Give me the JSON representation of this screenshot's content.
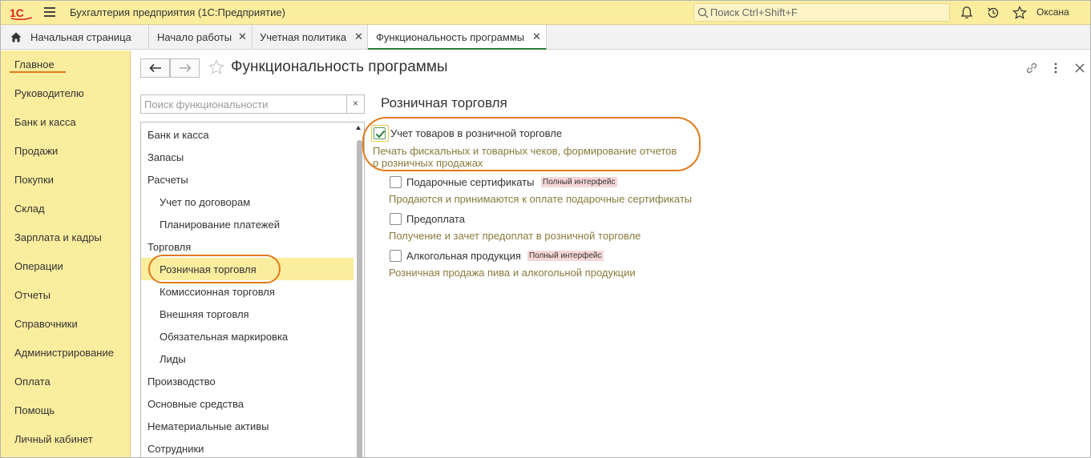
{
  "app": {
    "title": "Бухгалтерия предприятия  (1С:Предприятие)",
    "search_placeholder": "Поиск Ctrl+Shift+F",
    "user_name": "Оксана"
  },
  "tabs": [
    {
      "label": "Начальная страница"
    },
    {
      "label": "Начало работы"
    },
    {
      "label": "Учетная политика"
    },
    {
      "label": "Функциональность программы"
    }
  ],
  "sidebar": {
    "items": [
      {
        "label": "Главное"
      },
      {
        "label": "Руководителю"
      },
      {
        "label": "Банк и касса"
      },
      {
        "label": "Продажи"
      },
      {
        "label": "Покупки"
      },
      {
        "label": "Склад"
      },
      {
        "label": "Зарплата и кадры"
      },
      {
        "label": "Операции"
      },
      {
        "label": "Отчеты"
      },
      {
        "label": "Справочники"
      },
      {
        "label": "Администрирование"
      },
      {
        "label": "Оплата"
      },
      {
        "label": "Помощь"
      },
      {
        "label": "Личный кабинет"
      }
    ]
  },
  "page": {
    "title": "Функциональность программы",
    "search_placeholder": "Поиск функциональности",
    "clear_symbol": "×"
  },
  "tree": {
    "items": [
      {
        "label": "Банк и касса"
      },
      {
        "label": "Запасы"
      },
      {
        "label": "Расчеты"
      },
      {
        "label": "Учет по договорам"
      },
      {
        "label": "Планирование платежей"
      },
      {
        "label": "Торговля"
      },
      {
        "label": "Розничная торговля"
      },
      {
        "label": "Комиссионная торговля"
      },
      {
        "label": "Внешняя торговля"
      },
      {
        "label": "Обязательная маркировка"
      },
      {
        "label": "Лиды"
      },
      {
        "label": "Производство"
      },
      {
        "label": "Основные средства"
      },
      {
        "label": "Нематериальные активы"
      },
      {
        "label": "Сотрудники"
      }
    ]
  },
  "section": {
    "title": "Розничная торговля",
    "options": [
      {
        "label": "Учет товаров в розничной торговле",
        "checked": true,
        "desc_line1": "Печать фискальных и товарных чеков, формирование отчетов",
        "desc_line2": "о розничных продажах"
      },
      {
        "label": "Подарочные сертификаты",
        "checked": false,
        "badge": "Полный интерфейс",
        "desc": "Продаются и принимаются к оплате подарочные сертификаты"
      },
      {
        "label": "Предоплата",
        "checked": false,
        "desc": "Получение и зачет предоплат в розничной торговле"
      },
      {
        "label": "Алкогольная продукция",
        "checked": false,
        "badge": "Полный интерфейс",
        "desc": "Розничная продажа пива и алкогольной продукции"
      }
    ]
  },
  "colors": {
    "accent_bar": "#fbed9e",
    "highlight": "#e07b1c",
    "active_tab": "#2a7c3c",
    "desc_text": "#8a7a3c",
    "badge_bg": "#f6d7d7"
  },
  "icons": [
    "1c-logo",
    "menu-icon",
    "search-icon",
    "bell-icon",
    "history-icon",
    "star-icon",
    "home-icon",
    "back-arrow-icon",
    "forward-arrow-icon",
    "link-icon",
    "more-icon",
    "close-icon",
    "checkmark-icon"
  ]
}
